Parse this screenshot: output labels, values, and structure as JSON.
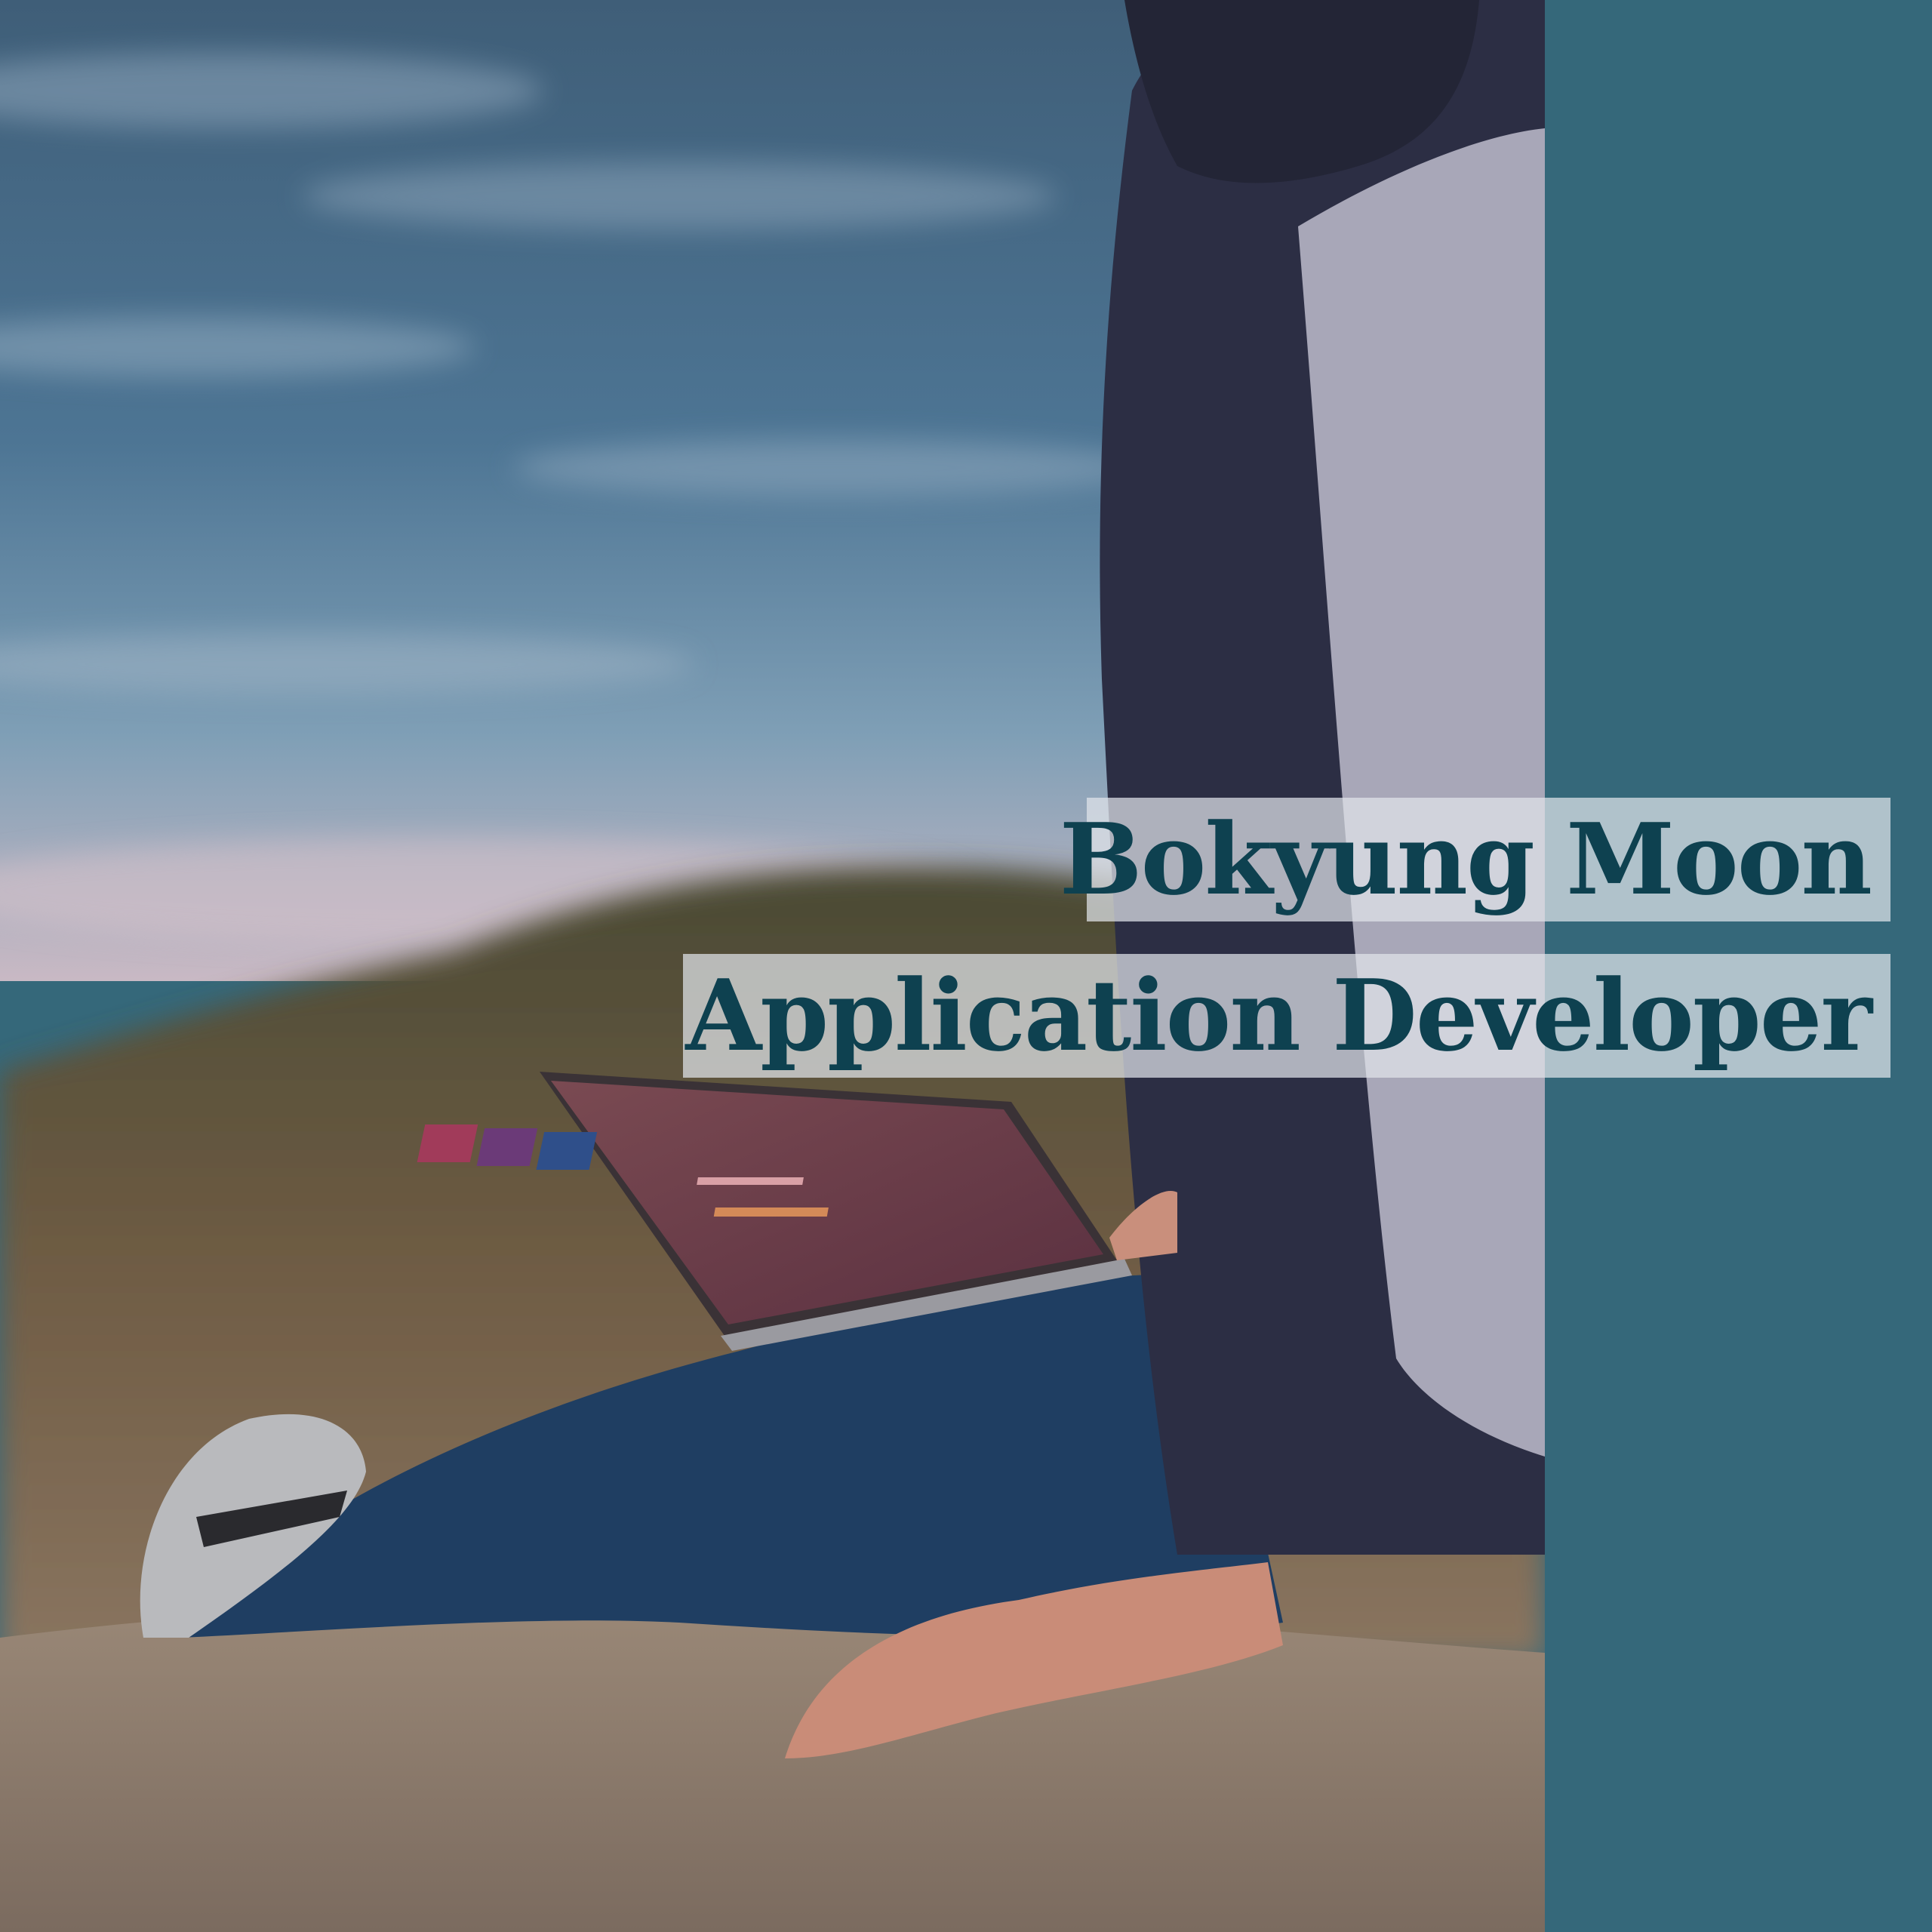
{
  "card": {
    "name": "Bokyung Moon",
    "role": "Application Developer"
  },
  "colors": {
    "panel": "#35687a",
    "title_text": "#0e4150",
    "title_box": "#e0e4ea"
  },
  "photo": {
    "subject": "person-with-laptop-icon"
  }
}
